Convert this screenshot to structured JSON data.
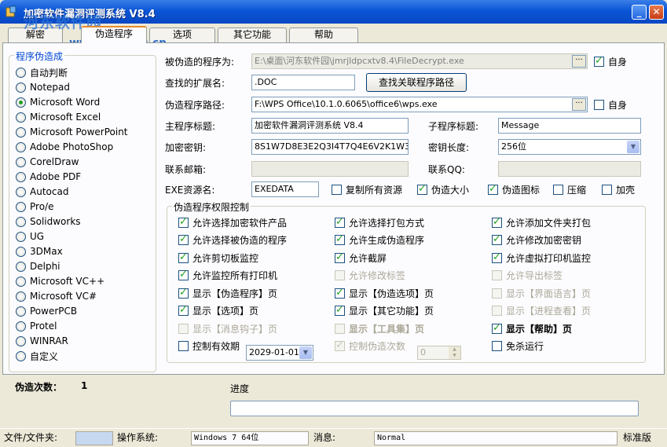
{
  "window": {
    "title": "加密软件漏洞评测系统  V8.4",
    "watermark_logo": "河东软件园",
    "watermark_url": "www.pc0359.cn",
    "min_label": "_",
    "close_label": "✕"
  },
  "tabs": [
    "解密",
    "伪造程序",
    "选项",
    "其它功能",
    "帮助"
  ],
  "active_tab": "伪造程序",
  "sidebar": {
    "title": "程序伪造成",
    "items": [
      "自动判断",
      "Notepad",
      "Microsoft Word",
      "Microsoft Excel",
      "Microsoft PowerPoint",
      "Adobe PhotoShop",
      "CorelDraw",
      "Adobe PDF",
      "Autocad",
      "Pro/e",
      "Solidworks",
      "UG",
      "3DMax",
      "Delphi",
      "Microsoft VC++",
      "Microsoft VC#",
      "PowerPCB",
      "Protel",
      "WINRAR",
      "自定义"
    ],
    "selected": "Microsoft Word"
  },
  "form": {
    "target_label": "被伪造的程序为:",
    "target_value": "E:\\桌面\\河东软件园\\jmrjldpcxtv8.4\\FileDecrypt.exe",
    "self1_label": "自身",
    "ext_label": "查找的扩展名:",
    "ext_value": ".DOC",
    "find_button": "查找关联程序路径",
    "path_label": "伪造程序路径:",
    "path_value": "F:\\WPS Office\\10.1.0.6065\\office6\\wps.exe",
    "self2_label": "自身",
    "main_title_label": "主程序标题:",
    "main_title_value": "加密软件漏洞评测系统  V8.4",
    "sub_title_label": "子程序标题:",
    "sub_title_value": "Message",
    "key_label": "加密密钥:",
    "key_value": "8S1W7D8E3E2Q3I4T7Q4E6V2K1W3E2",
    "key_len_label": "密钥长度:",
    "key_len_value": "256位",
    "email_label": "联系邮箱:",
    "email_value": "",
    "qq_label": "联系QQ:",
    "qq_value": "",
    "exe_res_label": "EXE资源名:",
    "exe_res_value": "EXEDATA",
    "copy_all_label": "复制所有资源",
    "fake_size_label": "伪造大小",
    "fake_icon_label": "伪造图标",
    "compress_label": "压缩",
    "shell_label": "加壳",
    "ellipsis": "···"
  },
  "perm": {
    "title": "伪造程序权限控制",
    "items": [
      {
        "label": "允许选择加密软件产品",
        "checked": true,
        "disabled": false,
        "bold": false
      },
      {
        "label": "允许选择打包方式",
        "checked": true,
        "disabled": false,
        "bold": false
      },
      {
        "label": "允许添加文件夹打包",
        "checked": true,
        "disabled": false,
        "bold": false
      },
      {
        "label": "允许选择被伪造的程序",
        "checked": true,
        "disabled": false,
        "bold": false
      },
      {
        "label": "允许生成伪造程序",
        "checked": true,
        "disabled": false,
        "bold": false
      },
      {
        "label": "允许修改加密密钥",
        "checked": true,
        "disabled": false,
        "bold": false
      },
      {
        "label": "允许剪切板监控",
        "checked": true,
        "disabled": false,
        "bold": false
      },
      {
        "label": "允许截屏",
        "checked": true,
        "disabled": false,
        "bold": false
      },
      {
        "label": "允许虚拟打印机监控",
        "checked": true,
        "disabled": false,
        "bold": false
      },
      {
        "label": "允许监控所有打印机",
        "checked": true,
        "disabled": false,
        "bold": false
      },
      {
        "label": "允许修改标签",
        "checked": false,
        "disabled": true,
        "bold": false
      },
      {
        "label": "允许导出标签",
        "checked": false,
        "disabled": true,
        "bold": false
      },
      {
        "label": "显示【伪造程序】页",
        "checked": true,
        "disabled": false,
        "bold": false
      },
      {
        "label": "显示【伪造选项】页",
        "checked": true,
        "disabled": false,
        "bold": false
      },
      {
        "label": "显示【界面语言】页",
        "checked": false,
        "disabled": true,
        "bold": false
      },
      {
        "label": "显示【选项】页",
        "checked": true,
        "disabled": false,
        "bold": false
      },
      {
        "label": "显示【其它功能】页",
        "checked": true,
        "disabled": false,
        "bold": false
      },
      {
        "label": "显示【进程查看】页",
        "checked": false,
        "disabled": true,
        "bold": false
      },
      {
        "label": "显示【消息钩子】页",
        "checked": false,
        "disabled": true,
        "bold": false
      },
      {
        "label": "显示【工具集】页",
        "checked": false,
        "disabled": true,
        "bold": true
      },
      {
        "label": "显示【帮助】页",
        "checked": true,
        "disabled": false,
        "bold": true
      },
      {
        "label": "控制有效期",
        "checked": false,
        "disabled": false,
        "bold": false
      },
      {
        "label": "控制伪造次数",
        "checked": true,
        "disabled": true,
        "bold": false
      },
      {
        "label": "免杀运行",
        "checked": false,
        "disabled": false,
        "bold": false
      }
    ],
    "date_value": "2029-01-01",
    "count_value": "0"
  },
  "bottom": {
    "fake_count_label": "伪造次数：",
    "fake_count_value": "1",
    "progress_label": "进度"
  },
  "status": {
    "file_label": "文件/文件夹:",
    "file_value": "",
    "os_label": "操作系统:",
    "os_value": "Windows 7 64位",
    "msg_label": "消息:",
    "msg_value": "Normal",
    "edition": "标准版"
  }
}
